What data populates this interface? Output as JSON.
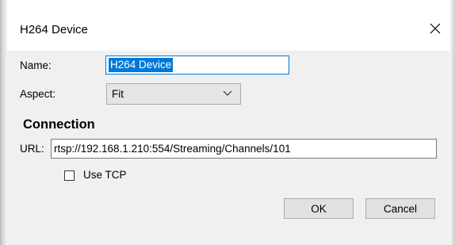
{
  "window": {
    "title": "H264 Device",
    "close_icon": "close-icon"
  },
  "form": {
    "name_label": "Name:",
    "name_value": "H264 Device",
    "aspect_label": "Aspect:",
    "aspect_value": "Fit",
    "aspect_icon": "chevron-down-icon",
    "connection_heading": "Connection",
    "url_label": "URL:",
    "url_value": "rtsp://192.168.1.210:554/Streaming/Channels/101",
    "use_tcp_label": "Use TCP",
    "use_tcp_checked": false
  },
  "buttons": {
    "ok_label": "OK",
    "cancel_label": "Cancel"
  },
  "colors": {
    "accent": "#0078d7",
    "client_bg": "#f0f0f0",
    "button_bg": "#e1e1e1"
  }
}
